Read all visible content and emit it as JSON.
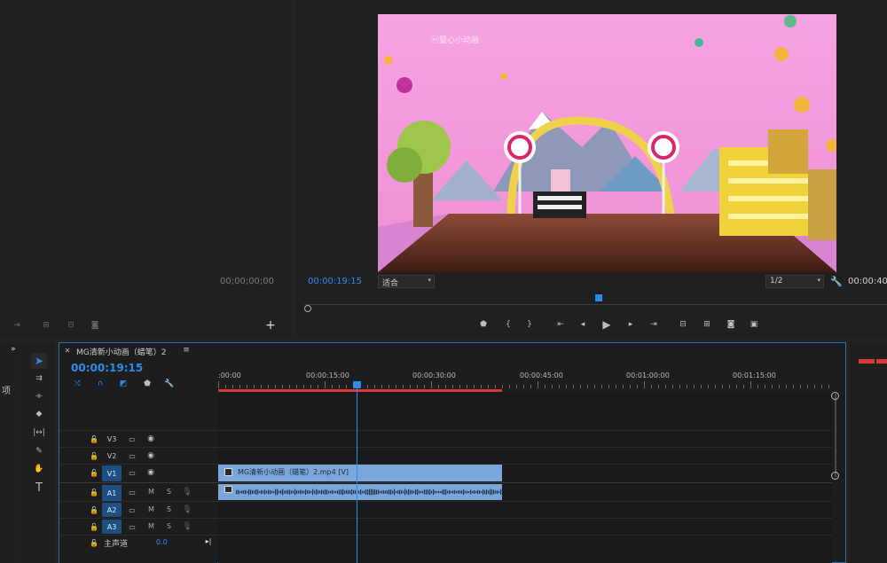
{
  "source_monitor": {
    "timecode": "00;00;00;00"
  },
  "program_monitor": {
    "timecode": "00:00:19:15",
    "fit_label": "适合",
    "resolution": "1/2",
    "duration_partial": "00:00:40",
    "video_watermark": "ⓜ婴心小动画"
  },
  "timeline": {
    "tab_title": "MG清新小动画（蜡笔）2",
    "timecode": "00:00:19:15",
    "ruler_labels": [
      ":00:00",
      "00:00:15:00",
      "00:00:30:00",
      "00:00:45:00",
      "00:01:00:00",
      "00:01:15:00"
    ],
    "video_tracks": [
      {
        "name": "V3",
        "active": false
      },
      {
        "name": "V2",
        "active": false
      },
      {
        "name": "V1",
        "active": true
      }
    ],
    "audio_tracks": [
      {
        "name": "A1",
        "m": "M",
        "s": "S"
      },
      {
        "name": "A2",
        "m": "M",
        "s": "S"
      },
      {
        "name": "A3",
        "m": "M",
        "s": "S"
      }
    ],
    "master_label": "主声道",
    "master_value": "0.0",
    "clip_video_label": "MG清新小动画（蜡笔）2.mp4 [V]",
    "playhead_fraction": 0.25
  },
  "left_edge_text": "项",
  "icons": {
    "playback": [
      "marker-icon",
      "mark-in-icon",
      "mark-out-icon",
      "go-to-in-icon",
      "step-back-icon",
      "play-icon",
      "step-forward-icon",
      "go-to-out-icon",
      "lift-icon",
      "extract-icon",
      "export-frame-icon",
      "compare-icon"
    ],
    "tools": [
      "selection-tool-icon",
      "track-select-icon",
      "ripple-edit-icon",
      "razor-icon",
      "slip-icon",
      "pen-icon",
      "hand-icon",
      "type-icon"
    ]
  },
  "colors": {
    "accent": "#2d8ceb",
    "clip": "#7aa6d9",
    "work_area": "#d63a3a"
  }
}
